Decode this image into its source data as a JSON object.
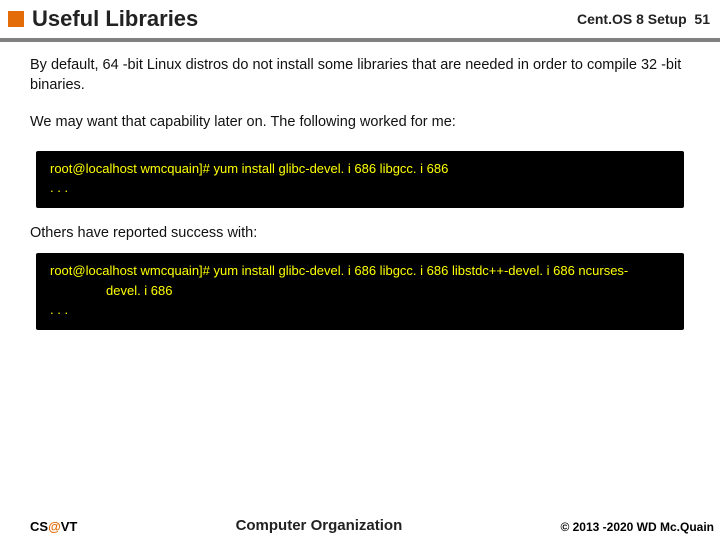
{
  "header": {
    "title": "Useful Libraries",
    "context": "Cent.OS 8 Setup",
    "page": "51"
  },
  "paragraphs": {
    "p1": "By default, 64 -bit Linux distros do not install some libraries that are needed in order to compile 32 -bit binaries.",
    "p2": "We may want that capability later on.  The following worked for me:",
    "others": "Others have reported success with:"
  },
  "terminal1": {
    "line1": "root@localhost wmcquain]# yum install glibc-devel. i 686 libgcc. i 686",
    "dots": ". . ."
  },
  "terminal2": {
    "line1": "root@localhost wmcquain]# yum install glibc-devel. i 686 libgcc. i 686 libstdc++-devel. i 686 ncurses-",
    "line2": "devel. i 686",
    "dots": ". . ."
  },
  "footer": {
    "left_cs": "CS",
    "left_at": "@",
    "left_vt": "VT",
    "center": "Computer Organization",
    "right": "© 2013 -2020 WD Mc.Quain"
  }
}
